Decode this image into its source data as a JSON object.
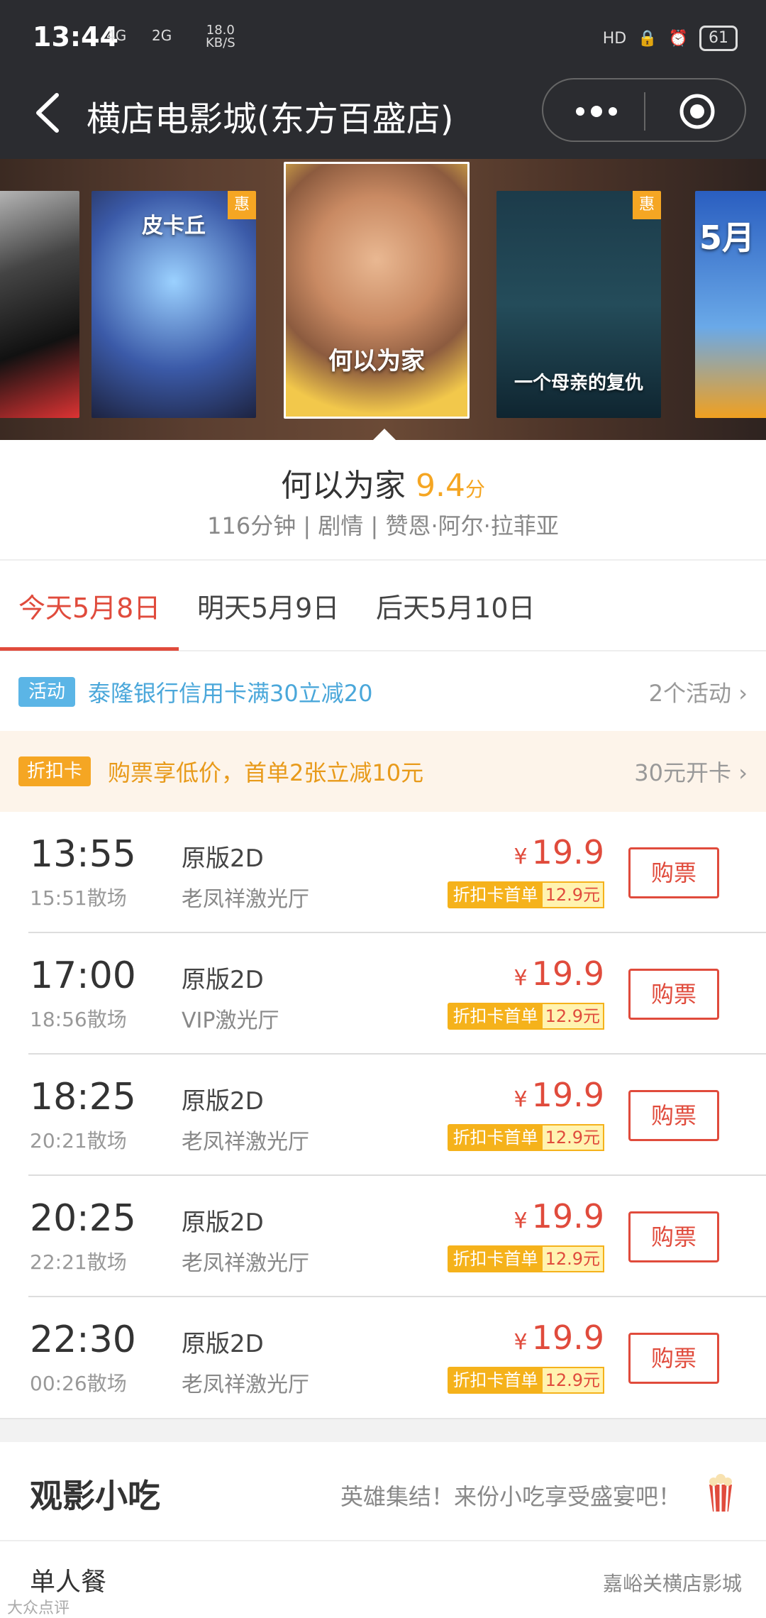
{
  "status_bar": {
    "time": "13:44",
    "signal1": "4G",
    "signal2": "2G",
    "speed_value": "18.0",
    "speed_unit": "KB/S",
    "hd": "HD",
    "battery": "61"
  },
  "header": {
    "title": "横店电影城(东方百盛店)"
  },
  "posters": [
    {
      "title": "",
      "badge": ""
    },
    {
      "title": "皮卡丘",
      "badge": "惠"
    },
    {
      "title": "何以为家",
      "badge": ""
    },
    {
      "title": "一个母亲的复仇",
      "badge": "惠"
    },
    {
      "title": "5月",
      "badge": ""
    }
  ],
  "movie": {
    "name": "何以为家",
    "score": "9.4",
    "score_unit": "分",
    "meta": "116分钟 | 剧情 | 赞恩·阿尔·拉菲亚"
  },
  "date_tabs": [
    {
      "label": "今天5月8日",
      "active": true
    },
    {
      "label": "明天5月9日",
      "active": false
    },
    {
      "label": "后天5月10日",
      "active": false
    }
  ],
  "promo_activity": {
    "badge": "活动",
    "text": "泰隆银行信用卡满30立减20",
    "more": "2个活动"
  },
  "promo_card": {
    "badge": "折扣卡",
    "text": "购票享低价，首单2张立减10元",
    "more": "30元开卡"
  },
  "showtimes": [
    {
      "start": "13:55",
      "end": "15:51散场",
      "version": "原版2D",
      "hall": "老凤祥激光厅",
      "yen": "¥",
      "price": "19.9",
      "card_label": "折扣卡首单",
      "card_price": "12.9元",
      "buy": "购票"
    },
    {
      "start": "17:00",
      "end": "18:56散场",
      "version": "原版2D",
      "hall": "VIP激光厅",
      "yen": "¥",
      "price": "19.9",
      "card_label": "折扣卡首单",
      "card_price": "12.9元",
      "buy": "购票"
    },
    {
      "start": "18:25",
      "end": "20:21散场",
      "version": "原版2D",
      "hall": "老凤祥激光厅",
      "yen": "¥",
      "price": "19.9",
      "card_label": "折扣卡首单",
      "card_price": "12.9元",
      "buy": "购票"
    },
    {
      "start": "20:25",
      "end": "22:21散场",
      "version": "原版2D",
      "hall": "老凤祥激光厅",
      "yen": "¥",
      "price": "19.9",
      "card_label": "折扣卡首单",
      "card_price": "12.9元",
      "buy": "购票"
    },
    {
      "start": "22:30",
      "end": "00:26散场",
      "version": "原版2D",
      "hall": "老凤祥激光厅",
      "yen": "¥",
      "price": "19.9",
      "card_label": "折扣卡首单",
      "card_price": "12.9元",
      "buy": "购票"
    }
  ],
  "snacks": {
    "heading": "观影小吃",
    "slogan": "英雄集结！来份小吃享受盛宴吧！",
    "meal_label": "单人餐"
  },
  "watermark": {
    "right": "嘉峪关横店影城",
    "left": "大众点评"
  },
  "colors": {
    "accent_red": "#e04b3c",
    "accent_orange": "#f5a623",
    "accent_blue": "#5bb5e6",
    "topbar": "#2b2c30"
  },
  "icons": {
    "back": "chevron-left-icon",
    "more": "more-dots-icon",
    "close": "target-icon",
    "snack": "popcorn-icon",
    "chevron": "chevron-right-icon"
  }
}
